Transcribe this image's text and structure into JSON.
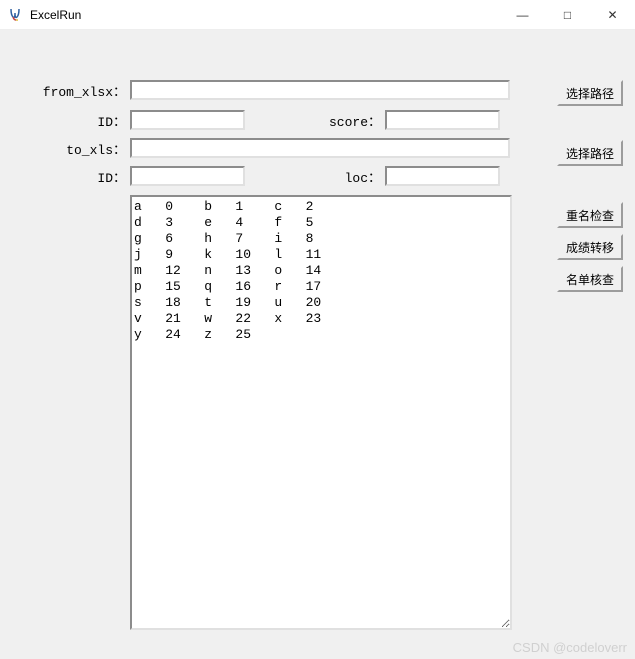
{
  "titlebar": {
    "title": "ExcelRun",
    "minimize": "—",
    "maximize": "□",
    "close": "✕"
  },
  "labels": {
    "from_xlsx": "from_xlsx：",
    "from_id": "ID：",
    "score": "score：",
    "to_xls": "to_xls：",
    "to_id": "ID：",
    "loc": "loc："
  },
  "inputs": {
    "from_xlsx": "",
    "from_id": "",
    "score": "",
    "to_xls": "",
    "to_id": "",
    "loc": ""
  },
  "buttons": {
    "choose_path1": "选择路径",
    "choose_path2": "选择路径",
    "dup_check": "重名检查",
    "score_transfer": "成绩转移",
    "list_verify": "名单核查"
  },
  "textarea_content": "a   0    b   1    c   2\nd   3    e   4    f   5\ng   6    h   7    i   8\nj   9    k   10   l   11\nm   12   n   13   o   14\np   15   q   16   r   17\ns   18   t   19   u   20\nv   21   w   22   x   23\ny   24   z   25",
  "watermark": "CSDN @codeloverr"
}
